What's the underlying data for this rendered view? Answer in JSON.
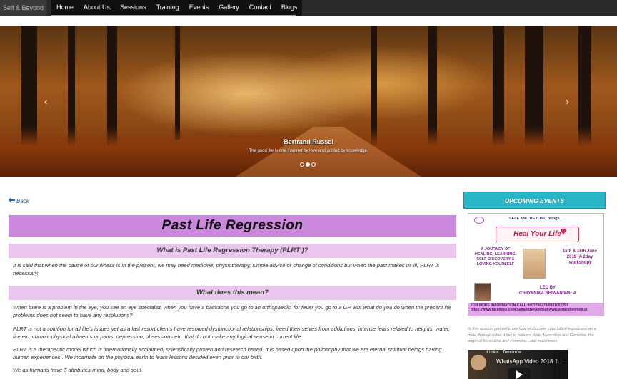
{
  "nav": {
    "brand": "Self & Beyond",
    "items": [
      "Home",
      "About Us",
      "Sessions",
      "Training",
      "Events",
      "Gallery",
      "Contact",
      "Blogs"
    ]
  },
  "hero": {
    "caption_title": "Bertrand Russel",
    "caption_text": "The good life is one inspired by love and guided by knowledge.",
    "prev_arrow": "‹",
    "next_arrow": "›",
    "slides_count": 3,
    "active_slide": 2
  },
  "content": {
    "back_label": "Back",
    "title": "Past Life Regression",
    "sections": [
      {
        "heading": "What is Past Life Regression Therapy (PLRT )?",
        "paragraphs": [
          "It is said that when the cause of our illness is in the present, we may need medicine, physiotherapy, simple advice or change of conditions but when the past makes us ill, PLRT is necessary."
        ]
      },
      {
        "heading": "What does this mean?",
        "paragraphs": [
          "When there is a problem in the eye, you see an eye specialist, when you have a backache you go to an orthopaedic, for fever you go to a GP. But what do you do when the present life problems does not seem to have any resolutions?",
          "PLRT is not a solution for all life’s issues yet as a last resort clients have resolved dysfunctional relationships, freed themselves from addictions, intense fears related to heights, water, fire etc.,chronic physical ailments or pains, depression, obsessions etc. that do not make any logical sense in current life.",
          "PLRT is a therapeutic model which is internationally acclaimed, scientifically proven and research based. It is based upon the philosophy that we are eternal spiritual beings having human experiences . We incarnate on the physical earth to learn lessons decided even prior to our birth.",
          "We as humans have 3 attributes-mind, body and soul."
        ]
      }
    ]
  },
  "sidebar": {
    "events_heading": "UPCOMING EVENTS",
    "poster": {
      "top": "SELF AND BEYOND brings...",
      "heading": "Heal Your Life",
      "left_text": "A JOURNEY OF HEALING, LEARNING, SELF DISCOVERY & LOVING YOURSELF",
      "date": "15th & 16th June 2019 (A 2day workshop)",
      "led_by": "LED BY",
      "leader": "CHAYANIKA BHIWANIWALA",
      "info": "FOR MORE INFORMATION CALL:9007706279/9831052297",
      "links": "https://www.facebook.com/SelfandBeyondkol   www.selfandbeyond.in"
    },
    "description": "In this session you will know how to discover your fullest expression as a male /female /other. How to balance Inner Masculine and Feminine, the origin of Masculine and Feminine...and much more.",
    "video": {
      "title": "WhatsApp Video 2018 1...",
      "overlay": "If I like...   Tomorrow I"
    }
  }
}
